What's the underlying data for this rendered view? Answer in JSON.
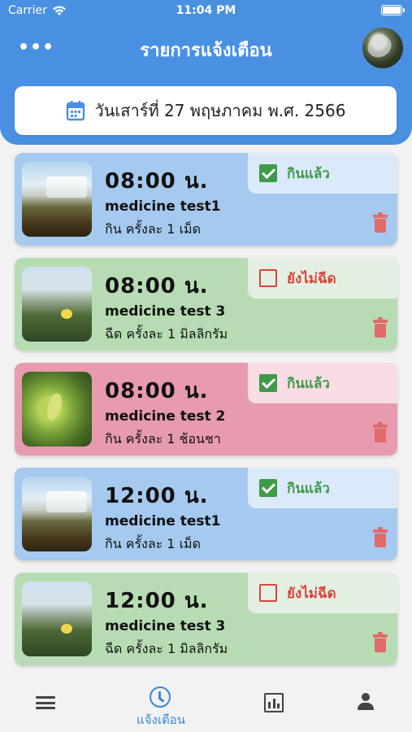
{
  "status_bar": {
    "carrier": "Carrier",
    "time": "11:04 PM"
  },
  "header": {
    "title": "รายการแจ้งเตือน"
  },
  "date_card": {
    "text": "วันเสาร์ที่ 27 พฤษภาคม พ.ศ. 2566"
  },
  "colors": {
    "header_blue": "#4a90e2",
    "taken_green": "#3f9a4a",
    "pending_red": "#d9443a"
  },
  "reminders": [
    {
      "time": "08:00 น.",
      "name": "medicine test1",
      "dose": "กิน ครั้งละ 1 เม็ด",
      "status": "กินแล้ว",
      "checked": true
    },
    {
      "time": "08:00 น.",
      "name": "medicine test 3",
      "dose": "ฉีด ครั้งละ 1 มิลลิกรัม",
      "status": "ยังไม่ฉีด",
      "checked": false
    },
    {
      "time": "08:00 น.",
      "name": "medicine test 2",
      "dose": "กิน ครั้งละ 1 ช้อนชา",
      "status": "กินแล้ว",
      "checked": true
    },
    {
      "time": "12:00 น.",
      "name": "medicine test1",
      "dose": "กิน ครั้งละ 1 เม็ด",
      "status": "กินแล้ว",
      "checked": true
    },
    {
      "time": "12:00 น.",
      "name": "medicine test 3",
      "dose": "ฉีด ครั้งละ 1 มิลลิกรัม",
      "status": "ยังไม่ฉีด",
      "checked": false
    }
  ],
  "bottom_nav": {
    "alarm_label": "แจ้งเตือน"
  },
  "icons": [
    "more-icon",
    "calendar-icon",
    "checkbox-icon",
    "trash-icon",
    "list-icon",
    "alarm-icon",
    "bar-chart-icon",
    "user-icon"
  ]
}
